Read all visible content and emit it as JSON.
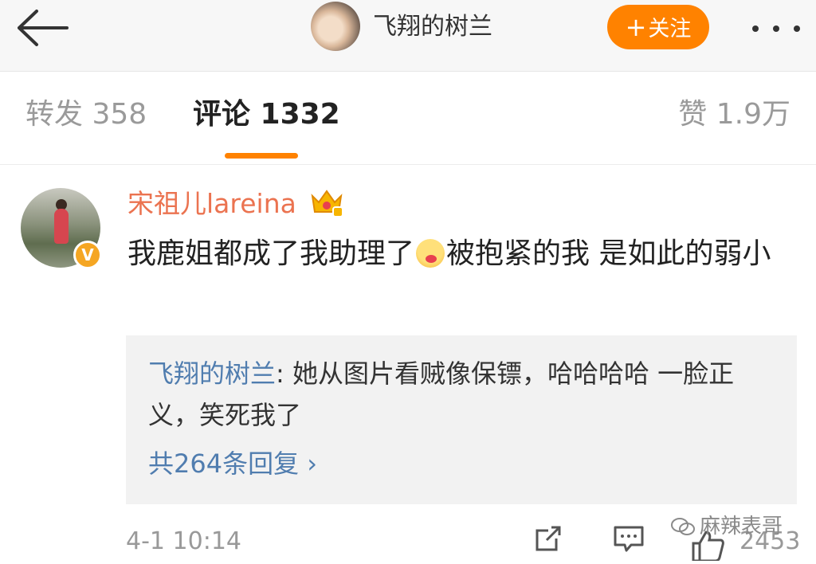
{
  "header": {
    "title": "飞翔的树兰",
    "follow_label": "关注",
    "follow_plus": "+"
  },
  "tabs": [
    {
      "label": "转发 358"
    },
    {
      "label": "评论 1332"
    },
    {
      "label": "赞 1.9万"
    }
  ],
  "comment": {
    "username": "宋祖儿lareina",
    "verified_badge": "V",
    "text_before_emoji": "我鹿姐都成了我助理了",
    "text_after_emoji": "被抱紧的我 是如此的弱小",
    "reply": {
      "name": "飞翔的树兰",
      "text": ": 她从图片看贼像保镖，哈哈哈哈 一脸正义，笑死我了",
      "more_label": "共264条回复 ›"
    },
    "time": "4-1 10:14",
    "like_count": "2453"
  },
  "watermark": "麻辣表哥",
  "colors": {
    "accent": "#ff8200",
    "username": "#eb7350",
    "link": "#507daf"
  },
  "icons": [
    "back-arrow-icon",
    "more-icon",
    "crown-icon",
    "emoji-icon",
    "repost-icon",
    "comment-icon",
    "like-icon",
    "wechat-icon"
  ]
}
